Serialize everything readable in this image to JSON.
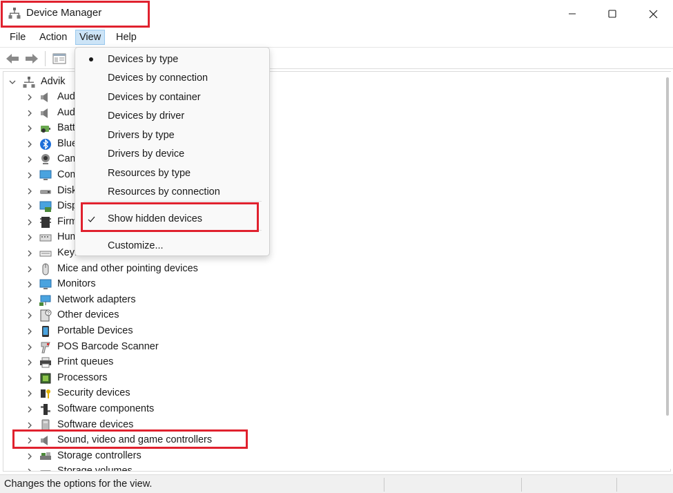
{
  "window": {
    "title": "Device Manager",
    "icon": "device-manager-icon"
  },
  "menubar": {
    "items": [
      "File",
      "Action",
      "View",
      "Help"
    ],
    "active": "View"
  },
  "view_menu": {
    "items": [
      {
        "label": "Devices by type",
        "mark": "bullet"
      },
      {
        "label": "Devices by connection",
        "mark": ""
      },
      {
        "label": "Devices by container",
        "mark": ""
      },
      {
        "label": "Devices by driver",
        "mark": ""
      },
      {
        "label": "Drivers by type",
        "mark": ""
      },
      {
        "label": "Drivers by device",
        "mark": ""
      },
      {
        "label": "Resources by type",
        "mark": ""
      },
      {
        "label": "Resources by connection",
        "mark": ""
      },
      {
        "label": "Show hidden devices",
        "mark": "check"
      },
      {
        "label": "Customize...",
        "mark": ""
      }
    ]
  },
  "tree": {
    "root": "Advik",
    "items": [
      {
        "label": "Aud",
        "icon": "speaker-icon"
      },
      {
        "label": "Aud",
        "icon": "speaker-icon"
      },
      {
        "label": "Batt",
        "icon": "battery-icon"
      },
      {
        "label": "Blue",
        "icon": "bluetooth-icon"
      },
      {
        "label": "Cam",
        "icon": "camera-icon"
      },
      {
        "label": "Com",
        "icon": "computer-icon"
      },
      {
        "label": "Disk",
        "icon": "disk-drive-icon"
      },
      {
        "label": "Disp",
        "icon": "display-adapter-icon"
      },
      {
        "label": "Firm",
        "icon": "firmware-icon"
      },
      {
        "label": "Hum",
        "icon": "hid-icon"
      },
      {
        "label": "Keyb",
        "icon": "keyboard-icon"
      },
      {
        "label": "Mice and other pointing devices",
        "icon": "mouse-icon"
      },
      {
        "label": "Monitors",
        "icon": "monitor-icon"
      },
      {
        "label": "Network adapters",
        "icon": "network-adapter-icon"
      },
      {
        "label": "Other devices",
        "icon": "other-device-icon"
      },
      {
        "label": "Portable Devices",
        "icon": "portable-device-icon"
      },
      {
        "label": "POS Barcode Scanner",
        "icon": "barcode-scanner-icon"
      },
      {
        "label": "Print queues",
        "icon": "printer-icon"
      },
      {
        "label": "Processors",
        "icon": "processor-icon"
      },
      {
        "label": "Security devices",
        "icon": "security-device-icon"
      },
      {
        "label": "Software components",
        "icon": "software-component-icon"
      },
      {
        "label": "Software devices",
        "icon": "software-device-icon"
      },
      {
        "label": "Sound, video and game controllers",
        "icon": "speaker-icon"
      },
      {
        "label": "Storage controllers",
        "icon": "storage-controller-icon"
      },
      {
        "label": "Storage volumes",
        "icon": "storage-volume-icon"
      }
    ]
  },
  "statusbar": {
    "text": "Changes the options for the view."
  },
  "colors": {
    "highlight": "#e0212e",
    "menu_active": "#cce4f7"
  }
}
